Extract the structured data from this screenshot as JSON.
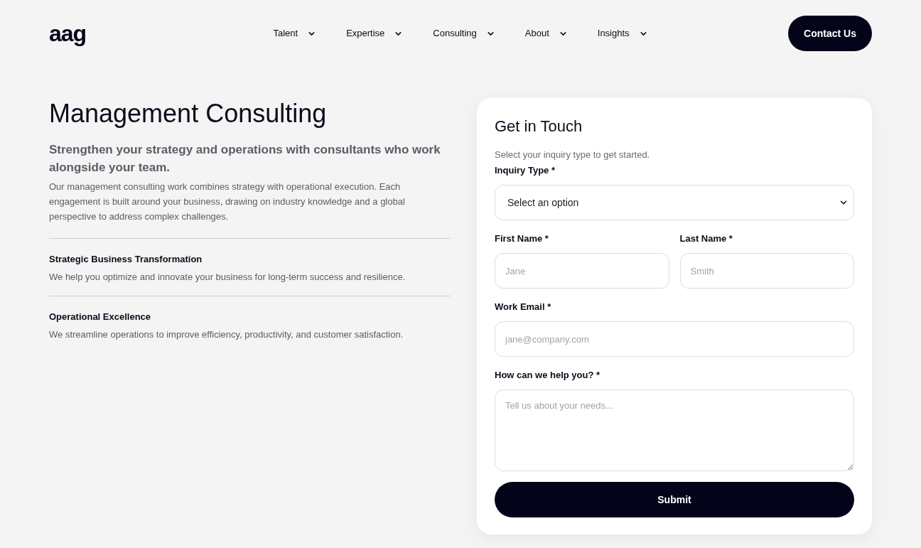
{
  "header": {
    "logo": "aag",
    "nav": [
      {
        "label": "Talent"
      },
      {
        "label": "Expertise"
      },
      {
        "label": "Consulting"
      },
      {
        "label": "About"
      },
      {
        "label": "Insights"
      }
    ],
    "cta": "Contact Us"
  },
  "intro": {
    "title": "Management Consulting",
    "subtitle": "Strengthen your strategy and operations with consultants who work alongside your team.",
    "body": "Our management consulting work combines strategy with operational execution. Each engagement is built around your business, drawing on industry knowledge and a global perspective to address complex challenges.",
    "services": [
      {
        "title": "Strategic Business Transformation",
        "description": "We help you optimize and innovate your business for long-term success and resilience."
      },
      {
        "title": "Operational Excellence",
        "description": "We streamline operations to improve efficiency, productivity, and customer satisfaction."
      }
    ]
  },
  "form": {
    "title": "Get in Touch",
    "hint": "Select your inquiry type to get started.",
    "rows": [
      {
        "fields": [
          {
            "kind": "select",
            "label": "Inquiry Type *",
            "value": "Select an option"
          }
        ]
      },
      {
        "fields": [
          {
            "kind": "text",
            "label": "First Name *",
            "placeholder": "Jane"
          },
          {
            "kind": "text",
            "label": "Last Name *",
            "placeholder": "Smith"
          }
        ]
      },
      {
        "fields": [
          {
            "kind": "text",
            "label": "Work Email *",
            "placeholder": "jane@company.com"
          }
        ]
      },
      {
        "fields": [
          {
            "kind": "textarea",
            "label": "How can we help you? *",
            "placeholder": "Tell us about your needs..."
          }
        ]
      }
    ],
    "submit": "Submit"
  }
}
